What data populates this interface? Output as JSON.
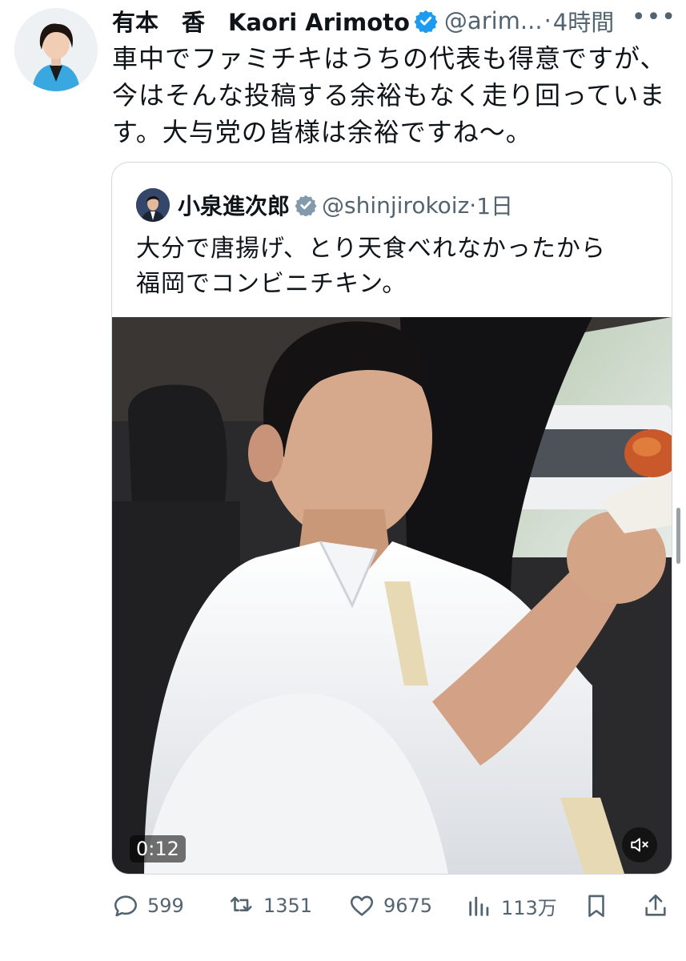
{
  "tweet": {
    "author_name": "有本　香　Kaori Arimoto",
    "handle": "@arim...",
    "separator": "·",
    "time": "4時間",
    "more": "•••",
    "text_lines": [
      "車中でファミチキはうちの代表も得意ですが、",
      "今はそんな投稿する余裕もなく走り回っていま",
      "す。大与党の皆様は余裕ですね〜。"
    ]
  },
  "quote": {
    "author_name": "小泉進次郎",
    "handle": "@shinjirokoiz",
    "separator": "·",
    "time": "1日",
    "text_lines": [
      "大分で唐揚げ、とり天食べれなかったから",
      "福岡でコンビニチキン。"
    ],
    "video": {
      "duration": "0:12",
      "muted": true
    }
  },
  "actions": {
    "replies": "599",
    "retweets": "1351",
    "likes": "9675",
    "views": "113万"
  },
  "colors": {
    "text": "#0f1419",
    "secondary": "#536471",
    "verified": "#1d9bf0",
    "quote_verified": "#829aab",
    "border": "#cfd9de"
  }
}
